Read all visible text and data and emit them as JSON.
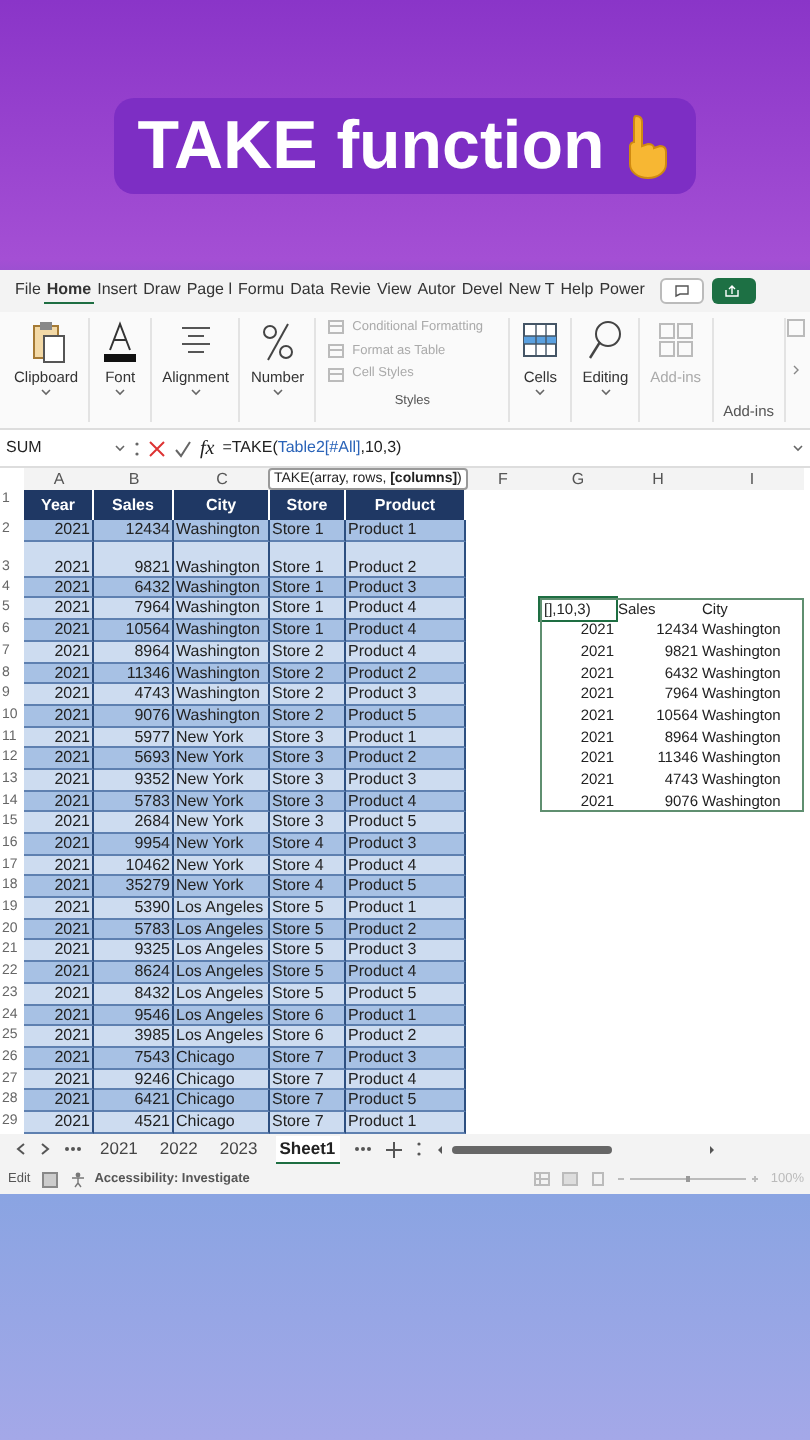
{
  "headline": "TAKE function",
  "menu_tabs": [
    {
      "label": "File",
      "selected": false
    },
    {
      "label": "Home",
      "selected": true
    },
    {
      "label": "Insert",
      "selected": false
    },
    {
      "label": "Draw",
      "selected": false
    },
    {
      "label": "Page l",
      "selected": false
    },
    {
      "label": "Formu",
      "selected": false
    },
    {
      "label": "Data",
      "selected": false
    },
    {
      "label": "Revie",
      "selected": false
    },
    {
      "label": "View",
      "selected": false
    },
    {
      "label": "Autor",
      "selected": false
    },
    {
      "label": "Devel",
      "selected": false
    },
    {
      "label": "New T",
      "selected": false
    },
    {
      "label": "Help",
      "selected": false
    },
    {
      "label": "Power",
      "selected": false
    }
  ],
  "ribbon": {
    "groups": [
      {
        "label": "Clipboard",
        "kind": "clipboard",
        "disabled": false
      },
      {
        "label": "Font",
        "kind": "font",
        "disabled": false
      },
      {
        "label": "Alignment",
        "kind": "alignment",
        "disabled": false
      },
      {
        "label": "Number",
        "kind": "number",
        "disabled": false
      }
    ],
    "styles": {
      "items": [
        "Conditional Formatting",
        "Format as Table",
        "Cell Styles"
      ],
      "label": "Styles"
    },
    "groups_right": [
      {
        "label": "Cells",
        "kind": "cells",
        "disabled": false
      },
      {
        "label": "Editing",
        "kind": "editing",
        "disabled": false
      },
      {
        "label": "Add-ins",
        "kind": "addins",
        "disabled": true
      }
    ],
    "addins_label": "Add-ins"
  },
  "formula_bar": {
    "name_box": "SUM",
    "fx": "fx",
    "parts": [
      {
        "text": "=TAKE(",
        "kind": "plain"
      },
      {
        "text": "Table2[#All]",
        "kind": "ref"
      },
      {
        "text": ",10,3)",
        "kind": "plain"
      }
    ]
  },
  "tooltip": "TAKE(array, rows, **[columns]**)",
  "column_headers": [
    "A",
    "B",
    "C",
    "F",
    "G",
    "H",
    "I"
  ],
  "row_numbers": [
    "1",
    "2",
    "3",
    "4",
    "5",
    "6",
    "7",
    "8",
    "9",
    "10",
    "11",
    "12",
    "13",
    "14",
    "15",
    "16",
    "17",
    "18",
    "19",
    "20",
    "21",
    "22",
    "23",
    "24",
    "25",
    "26",
    "27",
    "28",
    "29"
  ],
  "table": {
    "columns": [
      "Year",
      "Sales",
      "City",
      "Store",
      "Product"
    ],
    "rows": [
      [
        "2021",
        "12434",
        "Washington",
        "Store 1",
        "Product 1"
      ],
      [
        "2021",
        "9821",
        "Washington",
        "Store 1",
        "Product 2"
      ],
      [
        "2021",
        "6432",
        "Washington",
        "Store 1",
        "Product 3"
      ],
      [
        "2021",
        "7964",
        "Washington",
        "Store 1",
        "Product 4"
      ],
      [
        "2021",
        "10564",
        "Washington",
        "Store 1",
        "Product 4"
      ],
      [
        "2021",
        "8964",
        "Washington",
        "Store 2",
        "Product 4"
      ],
      [
        "2021",
        "11346",
        "Washington",
        "Store 2",
        "Product 2"
      ],
      [
        "2021",
        "4743",
        "Washington",
        "Store 2",
        "Product 3"
      ],
      [
        "2021",
        "9076",
        "Washington",
        "Store 2",
        "Product 5"
      ],
      [
        "2021",
        "5977",
        "New York",
        "Store 3",
        "Product 1"
      ],
      [
        "2021",
        "5693",
        "New York",
        "Store 3",
        "Product 2"
      ],
      [
        "2021",
        "9352",
        "New York",
        "Store 3",
        "Product 3"
      ],
      [
        "2021",
        "5783",
        "New York",
        "Store 3",
        "Product 4"
      ],
      [
        "2021",
        "2684",
        "New York",
        "Store 3",
        "Product 5"
      ],
      [
        "2021",
        "9954",
        "New York",
        "Store 4",
        "Product 3"
      ],
      [
        "2021",
        "10462",
        "New York",
        "Store 4",
        "Product 4"
      ],
      [
        "2021",
        "35279",
        "New York",
        "Store 4",
        "Product 5"
      ],
      [
        "2021",
        "5390",
        "Los Angeles",
        "Store 5",
        "Product 1"
      ],
      [
        "2021",
        "5783",
        "Los Angeles",
        "Store 5",
        "Product 2"
      ],
      [
        "2021",
        "9325",
        "Los Angeles",
        "Store 5",
        "Product 3"
      ],
      [
        "2021",
        "8624",
        "Los Angeles",
        "Store 5",
        "Product 4"
      ],
      [
        "2021",
        "8432",
        "Los Angeles",
        "Store 5",
        "Product 5"
      ],
      [
        "2021",
        "9546",
        "Los Angeles",
        "Store 6",
        "Product 1"
      ],
      [
        "2021",
        "3985",
        "Los Angeles",
        "Store 6",
        "Product 2"
      ],
      [
        "2021",
        "7543",
        "Chicago",
        "Store 7",
        "Product 3"
      ],
      [
        "2021",
        "9246",
        "Chicago",
        "Store 7",
        "Product 4"
      ],
      [
        "2021",
        "6421",
        "Chicago",
        "Store 7",
        "Product 5"
      ],
      [
        "2021",
        "4521",
        "Chicago",
        "Store 7",
        "Product 1"
      ]
    ]
  },
  "result": {
    "editing_cell": "[],10,3)",
    "headers": [
      "Sales",
      "City"
    ],
    "rows": [
      [
        "2021",
        "12434",
        "Washington"
      ],
      [
        "2021",
        "9821",
        "Washington"
      ],
      [
        "2021",
        "6432",
        "Washington"
      ],
      [
        "2021",
        "7964",
        "Washington"
      ],
      [
        "2021",
        "10564",
        "Washington"
      ],
      [
        "2021",
        "8964",
        "Washington"
      ],
      [
        "2021",
        "11346",
        "Washington"
      ],
      [
        "2021",
        "4743",
        "Washington"
      ],
      [
        "2021",
        "9076",
        "Washington"
      ]
    ]
  },
  "sheet_tabs": [
    {
      "label": "2021",
      "selected": false
    },
    {
      "label": "2022",
      "selected": false
    },
    {
      "label": "2023",
      "selected": false
    },
    {
      "label": "Sheet1",
      "selected": true
    }
  ],
  "status_bar": {
    "mode": "Edit",
    "accessibility": "Accessibility: Investigate",
    "zoom_slider": {
      "level": 0.5
    },
    "zoom": "100%"
  }
}
